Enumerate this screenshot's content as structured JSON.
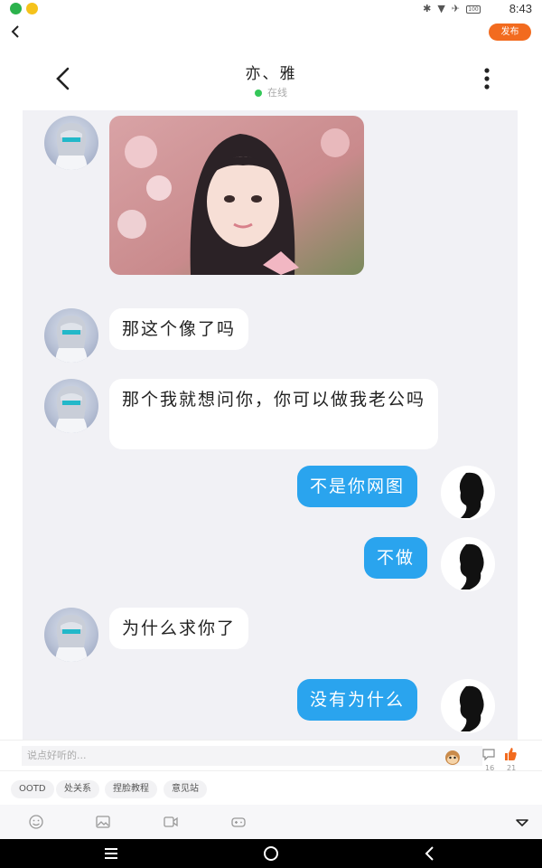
{
  "status_bar": {
    "time": "8:43",
    "battery": "100"
  },
  "top_bar": {
    "publish_label": "发布"
  },
  "chat": {
    "name": "亦、雅",
    "status": "在线",
    "messages": [
      {
        "side": "left",
        "type": "image"
      },
      {
        "side": "left",
        "type": "text",
        "text": "那这个像了吗"
      },
      {
        "side": "left",
        "type": "text",
        "text": "那个我就想问你，你可以做我老公吗"
      },
      {
        "side": "right",
        "type": "text",
        "text": "不是你网图"
      },
      {
        "side": "right",
        "type": "text",
        "text": "不做"
      },
      {
        "side": "left",
        "type": "text",
        "text": "为什么求你了"
      },
      {
        "side": "right",
        "type": "text",
        "text": "没有为什么"
      }
    ]
  },
  "comment_bar": {
    "placeholder": "说点好听的...",
    "comment_count": "16",
    "like_count": "21"
  },
  "tags": [
    "OOTD",
    "处关系",
    "捏脸教程",
    "意见站"
  ],
  "input_tools": [
    "emoji-icon",
    "image-icon",
    "video-icon",
    "game-icon"
  ],
  "colors": {
    "accent": "#f26b1f",
    "bubble_out": "#2aa4ee",
    "online": "#34c759"
  }
}
